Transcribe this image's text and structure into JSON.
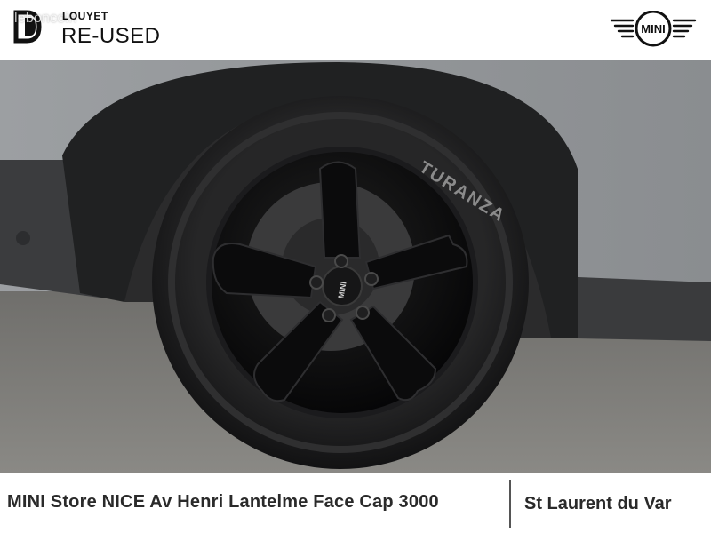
{
  "header": {
    "dealer_brand_small": "LOUYET",
    "dealer_brand_large": "RE-USED",
    "watermark": "leboncoin",
    "logo_icon": "louyet-logo-icon",
    "right_logo_icon": "mini-logo-icon",
    "right_logo_text": "MINI"
  },
  "photo": {
    "tyre_brand_text": "TURANZA",
    "hub_badge_text": "MINI",
    "colors": {
      "body_paint": "#8e9194",
      "wheel": "#0d0d0f",
      "tyre": "#1b1b1c",
      "ground": "#7d7c78"
    }
  },
  "footer": {
    "location_left": "MINI Store NICE Av Henri Lantelme Face Cap 3000",
    "location_right": "St Laurent du Var"
  }
}
